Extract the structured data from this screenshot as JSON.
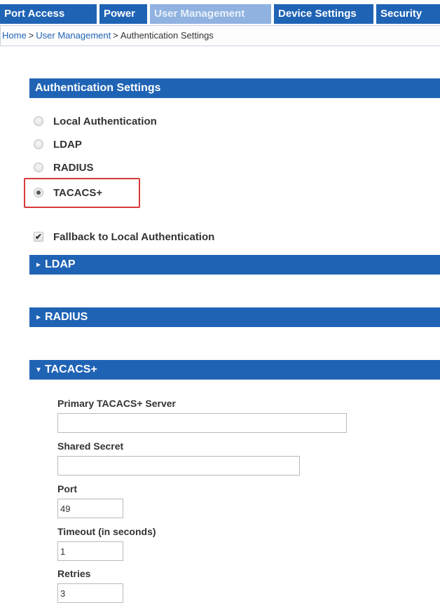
{
  "nav": {
    "tabs": [
      {
        "label": "Port Access",
        "active": false
      },
      {
        "label": "Power",
        "active": false
      },
      {
        "label": "User Management",
        "active": true
      },
      {
        "label": "Device Settings",
        "active": false
      },
      {
        "label": "Security",
        "active": false
      }
    ]
  },
  "breadcrumb": {
    "items": [
      "Home",
      "User Management",
      "Authentication Settings"
    ],
    "separator": ">"
  },
  "auth_settings": {
    "title": "Authentication Settings",
    "options": [
      {
        "label": "Local Authentication",
        "selected": false
      },
      {
        "label": "LDAP",
        "selected": false
      },
      {
        "label": "RADIUS",
        "selected": false
      },
      {
        "label": "TACACS+",
        "selected": true
      }
    ],
    "fallback": {
      "label": "Fallback to Local Authentication",
      "checked": true
    }
  },
  "sections": {
    "ldap": {
      "title": "LDAP",
      "expanded": false,
      "arrow": "►"
    },
    "radius": {
      "title": "RADIUS",
      "expanded": false,
      "arrow": "►"
    },
    "tacacs": {
      "title": "TACACS+",
      "expanded": true,
      "arrow": "▼"
    }
  },
  "tacacs_form": {
    "primary_server": {
      "label": "Primary TACACS+ Server",
      "value": ""
    },
    "shared_secret": {
      "label": "Shared Secret",
      "value": ""
    },
    "port": {
      "label": "Port",
      "value": "49"
    },
    "timeout": {
      "label": "Timeout (in seconds)",
      "value": "1"
    },
    "retries": {
      "label": "Retries",
      "value": "3"
    }
  },
  "colors": {
    "nav_blue": "#1f63b5",
    "nav_active": "#8fb2e0",
    "highlight_red": "#d93a3a"
  },
  "icons": {
    "checkmark": "✔"
  }
}
